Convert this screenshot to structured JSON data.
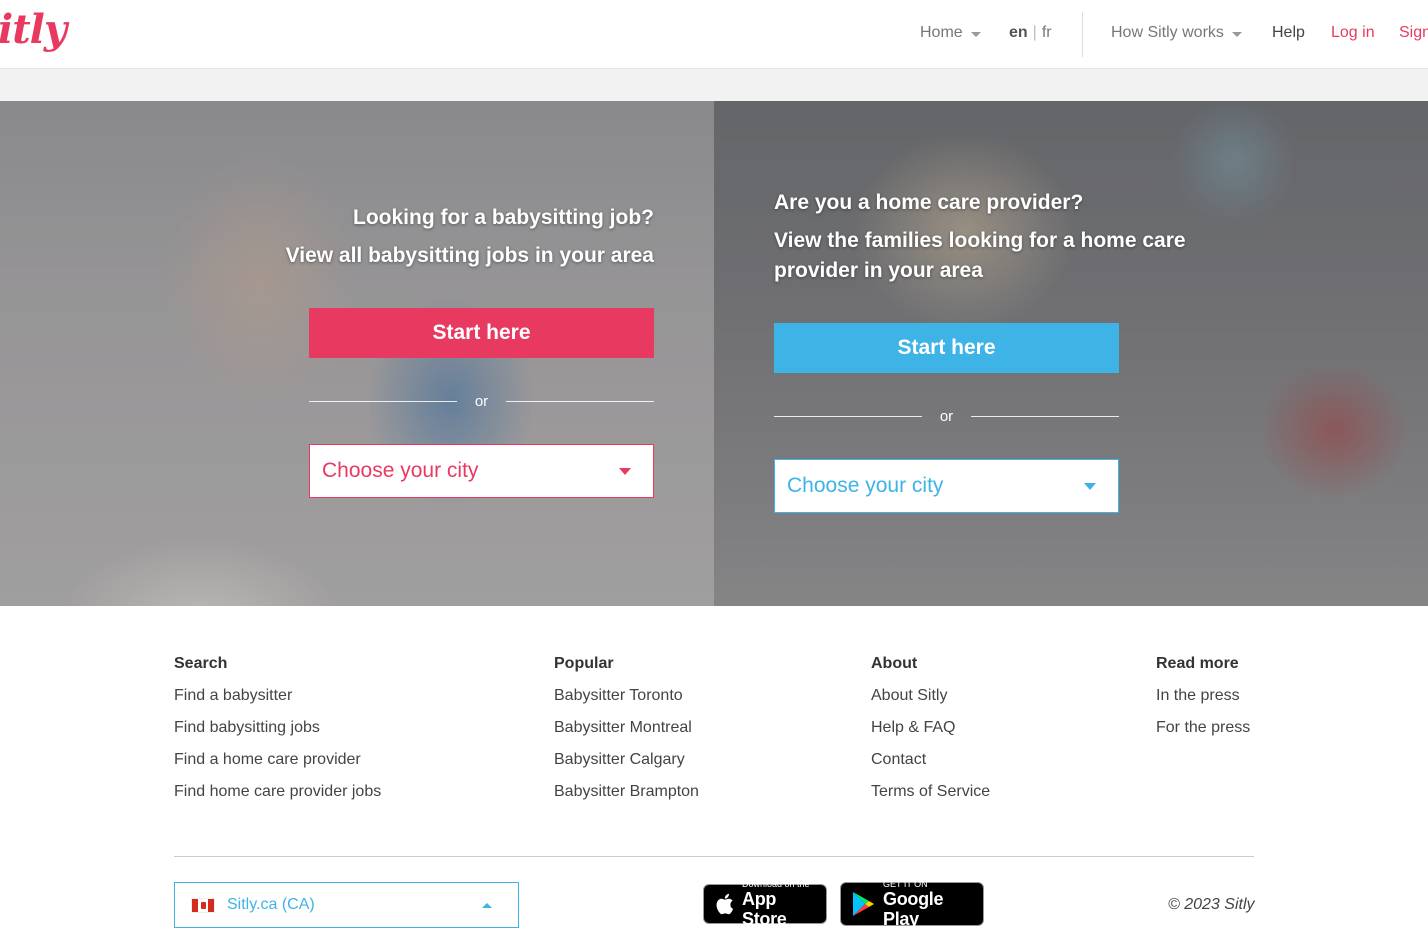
{
  "header": {
    "logo": "itly",
    "nav": {
      "home": "Home",
      "lang_en": "en",
      "lang_sep": "|",
      "lang_fr": "fr",
      "how_it_works": "How Sitly works",
      "help": "Help",
      "login": "Log in",
      "signup": "Sign"
    }
  },
  "hero_left": {
    "title_line1": "Looking for a babysitting job?",
    "title_line2": "View all babysitting jobs in your area",
    "start_button": "Start here",
    "or": "or",
    "city_placeholder": "Choose your city"
  },
  "hero_right": {
    "title_line1": "Are you a home care provider?",
    "title_line2": "View the families looking for a home care",
    "title_line3": "provider in your area",
    "start_button": "Start here",
    "or": "or",
    "city_placeholder": "Choose your city"
  },
  "footer": {
    "columns": [
      {
        "heading": "Search",
        "links": [
          "Find a babysitter",
          "Find babysitting jobs",
          "Find a home care provider",
          "Find home care provider jobs"
        ]
      },
      {
        "heading": "Popular",
        "links": [
          "Babysitter Toronto",
          "Babysitter Montreal",
          "Babysitter Calgary",
          "Babysitter Brampton"
        ]
      },
      {
        "heading": "About",
        "links": [
          "About Sitly",
          "Help & FAQ",
          "Contact",
          "Terms of Service"
        ]
      },
      {
        "heading": "Read more",
        "links": [
          "In the press",
          "For the press"
        ]
      }
    ],
    "country_select": "Sitly.ca (CA)",
    "app_store": {
      "small": "Download on the",
      "large": "App Store"
    },
    "google_play": {
      "small": "GET IT ON",
      "large": "Google Play"
    },
    "copyright": "© 2023 Sitly"
  },
  "colors": {
    "brand_pink": "#e83a61",
    "accent_blue": "#3eb3e6"
  },
  "icons": [
    "caret-down-icon",
    "canada-flag-icon",
    "caret-up-icon",
    "apple-icon",
    "google-play-icon"
  ]
}
